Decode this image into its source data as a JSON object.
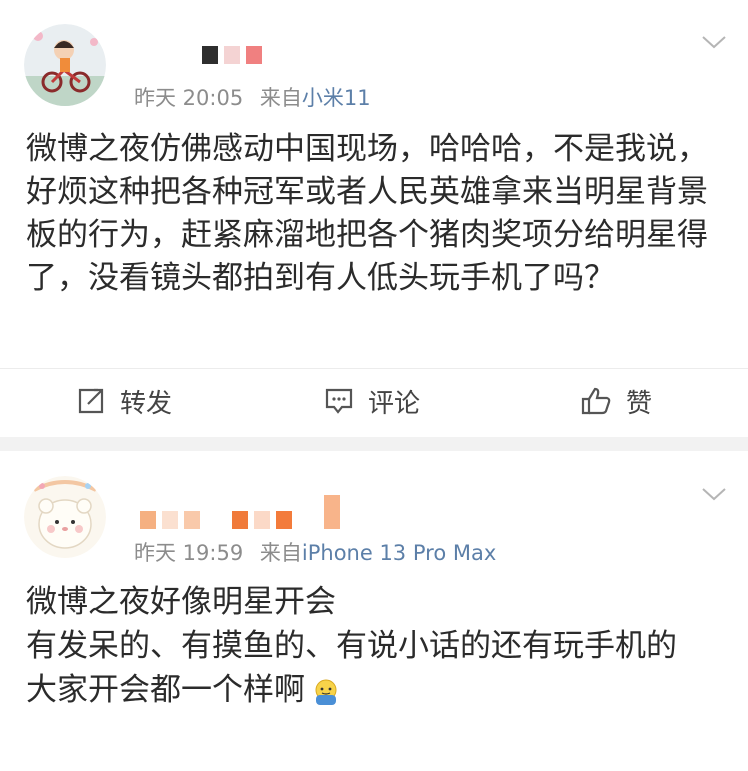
{
  "posts": [
    {
      "time": "昨天 20:05",
      "source_prefix": "来自",
      "device": "小米11",
      "content_lines": [
        "微博之夜仿佛感动中国现场，哈哈哈，不是我说，好烦这种把各种冠军或者人民英雄拿来当明星背景板的行为，赶紧麻溜地把各个猪肉奖项分给明星得了，没看镜头都拍到有人低头玩手机了吗？"
      ],
      "actions": {
        "repost": "转发",
        "comment": "评论",
        "like": "赞"
      }
    },
    {
      "time": "昨天 19:59",
      "source_prefix": "来自",
      "device": "iPhone 13 Pro Max",
      "content_lines": [
        "微博之夜好像明星开会",
        "有发呆的、有摸鱼的、有说小话的还有玩手机的",
        "大家开会都一个样啊"
      ]
    }
  ],
  "colors": {
    "text": "#2b2b2b",
    "meta": "#8c8c8c",
    "device_link": "#5c7fa8",
    "separator": "#f2f2f2"
  },
  "icons": [
    "chevron-down-icon",
    "repost-icon",
    "comment-icon",
    "like-icon",
    "emoji-icon"
  ]
}
